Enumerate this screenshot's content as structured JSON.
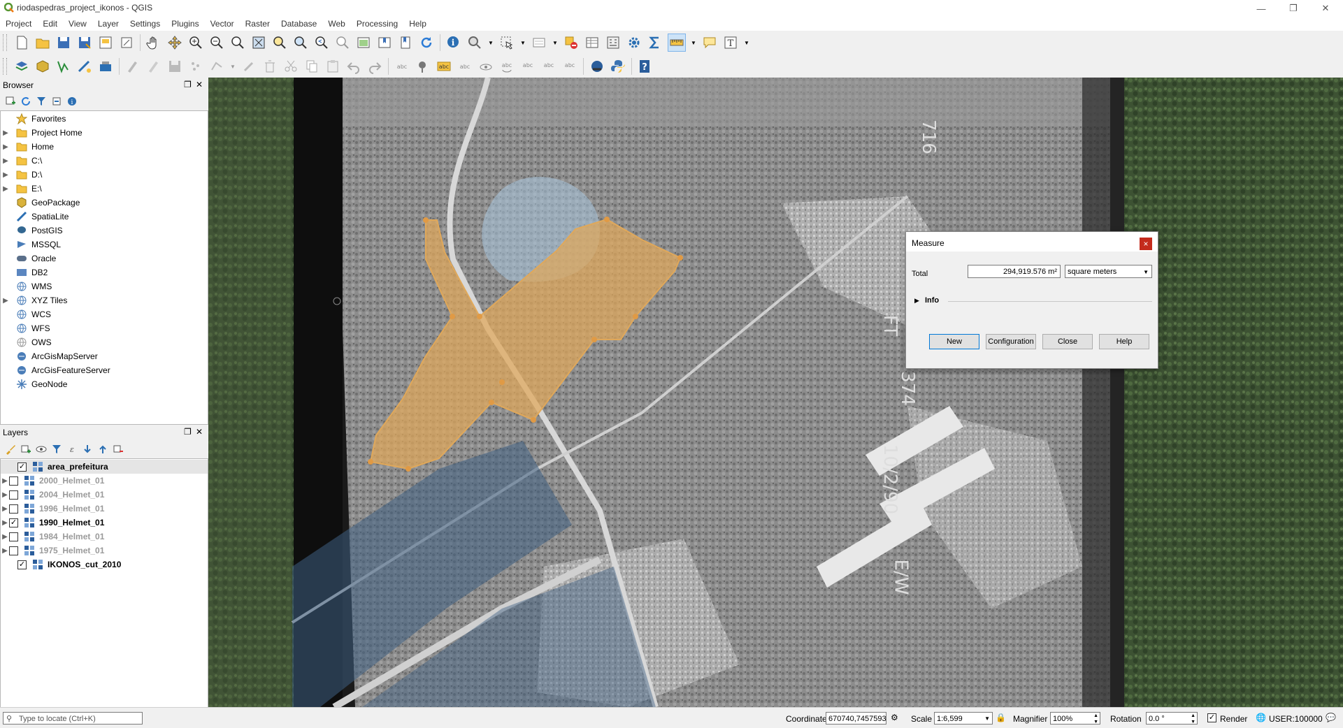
{
  "window": {
    "title": "riodaspedras_project_ikonos - QGIS"
  },
  "menu": [
    "Project",
    "Edit",
    "View",
    "Layer",
    "Settings",
    "Plugins",
    "Vector",
    "Raster",
    "Database",
    "Web",
    "Processing",
    "Help"
  ],
  "browser": {
    "title": "Browser",
    "items": [
      {
        "label": "Favorites",
        "icon": "star-icon",
        "expandable": false
      },
      {
        "label": "Project Home",
        "icon": "folder-icon",
        "expandable": true
      },
      {
        "label": "Home",
        "icon": "folder-icon",
        "expandable": true
      },
      {
        "label": "C:\\",
        "icon": "folder-icon",
        "expandable": true
      },
      {
        "label": "D:\\",
        "icon": "folder-icon",
        "expandable": true
      },
      {
        "label": "E:\\",
        "icon": "folder-icon",
        "expandable": true
      },
      {
        "label": "GeoPackage",
        "icon": "geopackage-icon",
        "expandable": false
      },
      {
        "label": "SpatiaLite",
        "icon": "spatialite-icon",
        "expandable": false
      },
      {
        "label": "PostGIS",
        "icon": "postgis-icon",
        "expandable": false
      },
      {
        "label": "MSSQL",
        "icon": "mssql-icon",
        "expandable": false
      },
      {
        "label": "Oracle",
        "icon": "oracle-icon",
        "expandable": false
      },
      {
        "label": "DB2",
        "icon": "db2-icon",
        "expandable": false
      },
      {
        "label": "WMS",
        "icon": "globe-icon",
        "expandable": false
      },
      {
        "label": "XYZ Tiles",
        "icon": "globe-icon",
        "expandable": true
      },
      {
        "label": "WCS",
        "icon": "globe-icon",
        "expandable": false
      },
      {
        "label": "WFS",
        "icon": "globe-icon",
        "expandable": false
      },
      {
        "label": "OWS",
        "icon": "globe-icon",
        "expandable": false
      },
      {
        "label": "ArcGisMapServer",
        "icon": "arcgis-icon",
        "expandable": false
      },
      {
        "label": "ArcGisFeatureServer",
        "icon": "arcgis-icon",
        "expandable": false
      },
      {
        "label": "GeoNode",
        "icon": "geonode-icon",
        "expandable": false
      }
    ]
  },
  "layers": {
    "title": "Layers",
    "items": [
      {
        "label": "area_prefeitura",
        "checked": true,
        "expandable": false,
        "selected": true
      },
      {
        "label": "2000_Helmet_01",
        "checked": false,
        "expandable": true
      },
      {
        "label": "2004_Helmet_01",
        "checked": false,
        "expandable": true
      },
      {
        "label": "1996_Helmet_01",
        "checked": false,
        "expandable": true
      },
      {
        "label": "1990_Helmet_01",
        "checked": true,
        "expandable": true
      },
      {
        "label": "1984_Helmet_01",
        "checked": false,
        "expandable": true
      },
      {
        "label": "1975_Helmet_01",
        "checked": false,
        "expandable": true
      },
      {
        "label": "IKONOS_cut_2010",
        "checked": true,
        "expandable": false
      }
    ]
  },
  "measure": {
    "title": "Measure",
    "total_label": "Total",
    "total_value": "294,919.576 m²",
    "unit": "square meters",
    "info_label": "Info",
    "buttons": {
      "new": "New",
      "configuration": "Configuration",
      "close": "Close",
      "help": "Help"
    }
  },
  "map_labels": [
    "716",
    "FT",
    "374",
    "10/2/90",
    "E/W"
  ],
  "status": {
    "locator_placeholder": "Type to locate (Ctrl+K)",
    "coordinate_label": "Coordinate",
    "coordinate_value": "670740,7457593",
    "scale_label": "Scale",
    "scale_value": "1:6,599",
    "magnifier_label": "Magnifier",
    "magnifier_value": "100%",
    "rotation_label": "Rotation",
    "rotation_value": "0.0 °",
    "render_label": "Render",
    "crs_label": "USER:100000"
  },
  "colors": {
    "polygon_fill": "#e0a85a",
    "accent_blue": "#2b6fb3",
    "close_red": "#c42b1c"
  }
}
